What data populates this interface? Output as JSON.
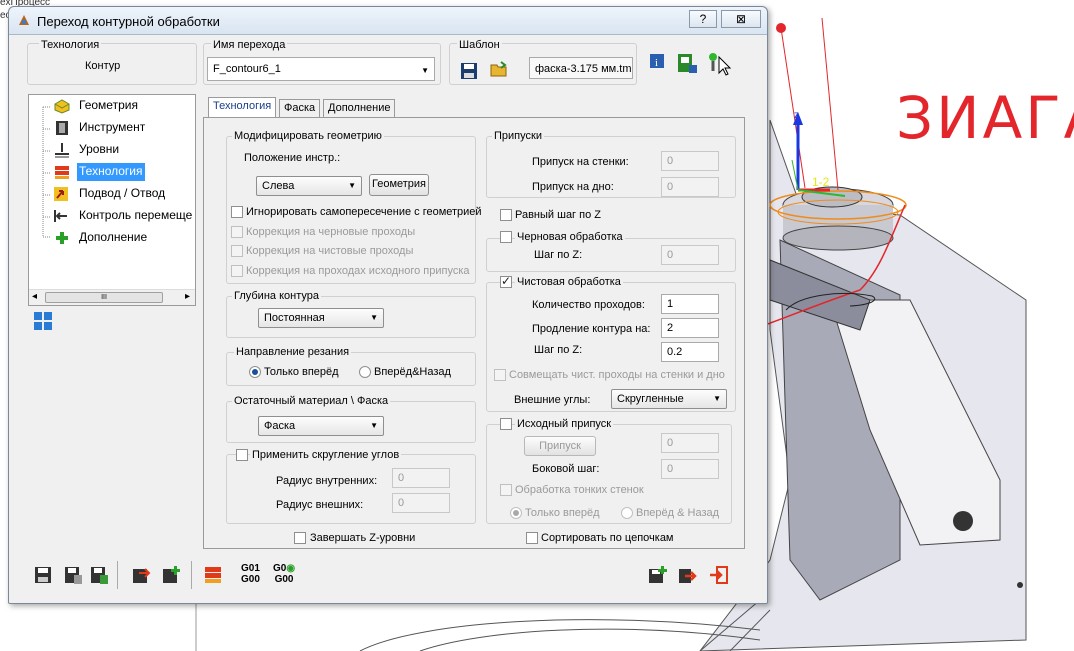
{
  "background": {
    "left_text": [
      "exПроцесс",
      "ео",
      "е",
      "",
      ""
    ],
    "hand_text": "ЗИАГА",
    "axis_label": "z",
    "point_label": "1-2"
  },
  "window": {
    "title": "Переход контурной обработки",
    "help_label": "?",
    "close_label": "⊠"
  },
  "top": {
    "technology_label": "Технология",
    "technology_value": "Контур",
    "name_label": "Имя перехода",
    "name_value": "F_contour6_1",
    "template_label": "Шаблон",
    "template_value": "фаска-3.175 мм.tmp"
  },
  "tree": {
    "items": [
      {
        "label": "Геометрия"
      },
      {
        "label": "Инструмент"
      },
      {
        "label": "Уровни"
      },
      {
        "label": "Технология"
      },
      {
        "label": "Подвод / Отвод"
      },
      {
        "label": "Контроль перемеще"
      },
      {
        "label": "Дополнение"
      }
    ],
    "scroll_left": "◂",
    "scroll_right": "▸",
    "scroll_thumb": "III"
  },
  "tabs": [
    "Технология",
    "Фаска",
    "Дополнение"
  ],
  "modify": {
    "title": "Модифицировать геометрию",
    "pos_label": "Положение инстр.:",
    "pos_value": "Слева",
    "geometry_button": "Геометрия",
    "ignore_self": "Игнорировать самопересечение с геометрией",
    "corr_rough": "Коррекция на черновые проходы",
    "corr_finish": "Коррекция на чистовые проходы",
    "corr_stock": "Коррекция на проходах исходного припуска"
  },
  "depth": {
    "title": "Глубина контура",
    "value": "Постоянная"
  },
  "direction": {
    "title": "Направление резания",
    "forward": "Только вперёд",
    "both": "Вперёд&Назад"
  },
  "residual": {
    "title": "Остаточный материал \\ Фаска",
    "value": "Фаска"
  },
  "corner": {
    "title": "Применить скругление углов",
    "inner_label": "Радиус внутренних:",
    "inner_value": "0",
    "outer_label": "Радиус внешних:",
    "outer_value": "0"
  },
  "finish_z": "Завершать Z-уровни",
  "allowance": {
    "title": "Припуски",
    "wall_label": "Припуск на стенки:",
    "wall_value": "0",
    "floor_label": "Припуск на дно:",
    "floor_value": "0"
  },
  "even_step": "Равный шаг по Z",
  "rough": {
    "title": "Черновая обработка",
    "step_label": "Шаг по Z:",
    "step_value": "0"
  },
  "finish": {
    "title": "Чистовая обработка",
    "passes_label": "Количество проходов:",
    "passes_value": "1",
    "extend_label": "Продление контура на:",
    "extend_value": "2",
    "step_label": "Шаг по Z:",
    "step_value": "0.2",
    "combine": "Совмещать чист. проходы на стенки и дно",
    "outer_label": "Внешние углы:",
    "outer_value": "Скругленные"
  },
  "stock": {
    "title": "Исходный припуск",
    "button": "Припуск",
    "value1": "0",
    "side_label": "Боковой шаг:",
    "side_value": "0",
    "thin_walls": "Обработка тонких стенок",
    "forward": "Только вперёд",
    "both": "Вперёд & Назад"
  },
  "sort_chains": "Сортировать по цепочкам",
  "bottom": {
    "g01": "G01",
    "g00": "G00",
    "g0": "G0",
    "g00b": "G00"
  },
  "colors": {
    "accent": "#3399ff",
    "hand_red": "#e3262b",
    "window_bg": "#f0f0f0"
  }
}
